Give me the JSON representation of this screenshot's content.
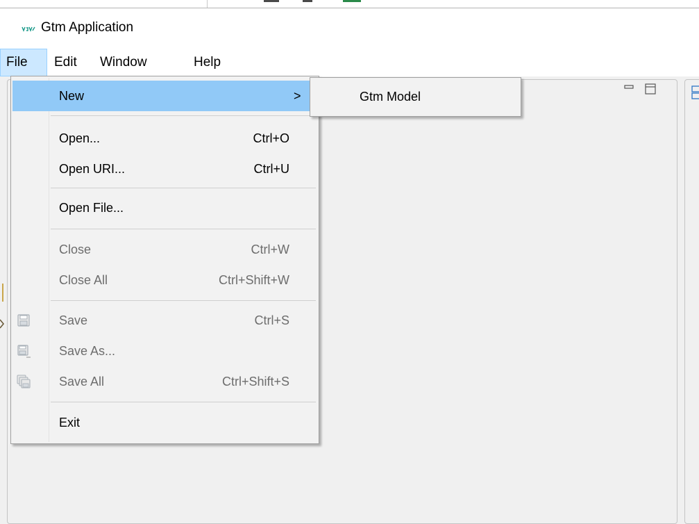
{
  "window": {
    "title": "Gtm Application",
    "icon": "gtm-app-icon"
  },
  "menubar": {
    "items": [
      {
        "label": "File",
        "active": true
      },
      {
        "label": "Edit"
      },
      {
        "label": "Window"
      },
      {
        "label": "Help"
      }
    ]
  },
  "file_menu": {
    "new": {
      "label": "New",
      "submenu_arrow": ">"
    },
    "open": {
      "label": "Open...",
      "shortcut": "Ctrl+O"
    },
    "open_uri": {
      "label": "Open URI...",
      "shortcut": "Ctrl+U"
    },
    "open_file": {
      "label": "Open File..."
    },
    "close": {
      "label": "Close",
      "shortcut": "Ctrl+W",
      "enabled": false
    },
    "close_all": {
      "label": "Close All",
      "shortcut": "Ctrl+Shift+W",
      "enabled": false
    },
    "save": {
      "label": "Save",
      "shortcut": "Ctrl+S",
      "enabled": false,
      "icon": "save-icon"
    },
    "save_as": {
      "label": "Save As...",
      "enabled": false,
      "icon": "save-as-icon"
    },
    "save_all": {
      "label": "Save All",
      "shortcut": "Ctrl+Shift+S",
      "enabled": false,
      "icon": "save-all-icon"
    },
    "exit": {
      "label": "Exit"
    }
  },
  "new_submenu": {
    "items": [
      {
        "label": "Gtm Model"
      }
    ]
  },
  "colors": {
    "highlight": "#91c9f7",
    "menubar_active": "#cce8ff",
    "disabled_text": "#6d6d6d",
    "workbench_bg": "#f0f0f0"
  }
}
